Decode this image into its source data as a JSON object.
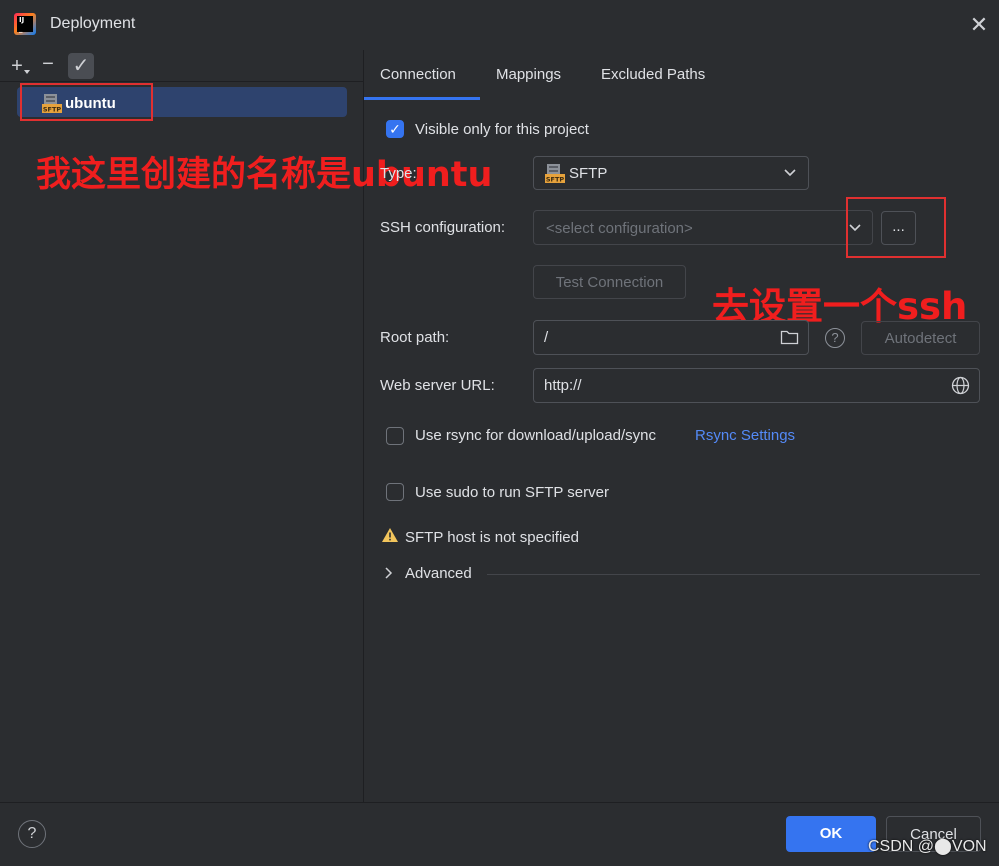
{
  "window": {
    "title": "Deployment"
  },
  "left": {
    "toolbar": {
      "add": "+",
      "remove": "−",
      "apply": "✓"
    },
    "items": [
      {
        "label": "ubuntu",
        "type_icon_text": "SFTP"
      }
    ],
    "annotation": "我这里创建的名称是ubuntu"
  },
  "tabs": [
    {
      "label": "Connection",
      "active": true
    },
    {
      "label": "Mappings",
      "active": false
    },
    {
      "label": "Excluded Paths",
      "active": false
    }
  ],
  "form": {
    "visible_only": {
      "label": "Visible only for this project",
      "checked": true
    },
    "type": {
      "label": "Type:",
      "value": "SFTP",
      "icon_text": "SFTP"
    },
    "ssh_config": {
      "label": "SSH configuration:",
      "placeholder": "<select configuration>",
      "browse": "..."
    },
    "test_connection": "Test Connection",
    "root_path": {
      "label": "Root path:",
      "value": "/",
      "autodetect": "Autodetect"
    },
    "web_server_url": {
      "label": "Web server URL:",
      "value": "http://"
    },
    "rsync": {
      "label": "Use rsync for download/upload/sync",
      "link": "Rsync Settings",
      "checked": false
    },
    "sudo": {
      "label": "Use sudo to run SFTP server",
      "checked": false
    },
    "warning": "SFTP host is not specified",
    "advanced": "Advanced"
  },
  "annotation_right": "去设置一个ssh",
  "footer": {
    "ok": "OK",
    "cancel": "Cancel",
    "help": "?"
  },
  "watermark": "CSDN @⬤VON",
  "colors": {
    "accent": "#3574f0",
    "selection": "#2e436e",
    "annotation": "#f01e1e",
    "link": "#548af7",
    "warning": "#f2c55c"
  }
}
